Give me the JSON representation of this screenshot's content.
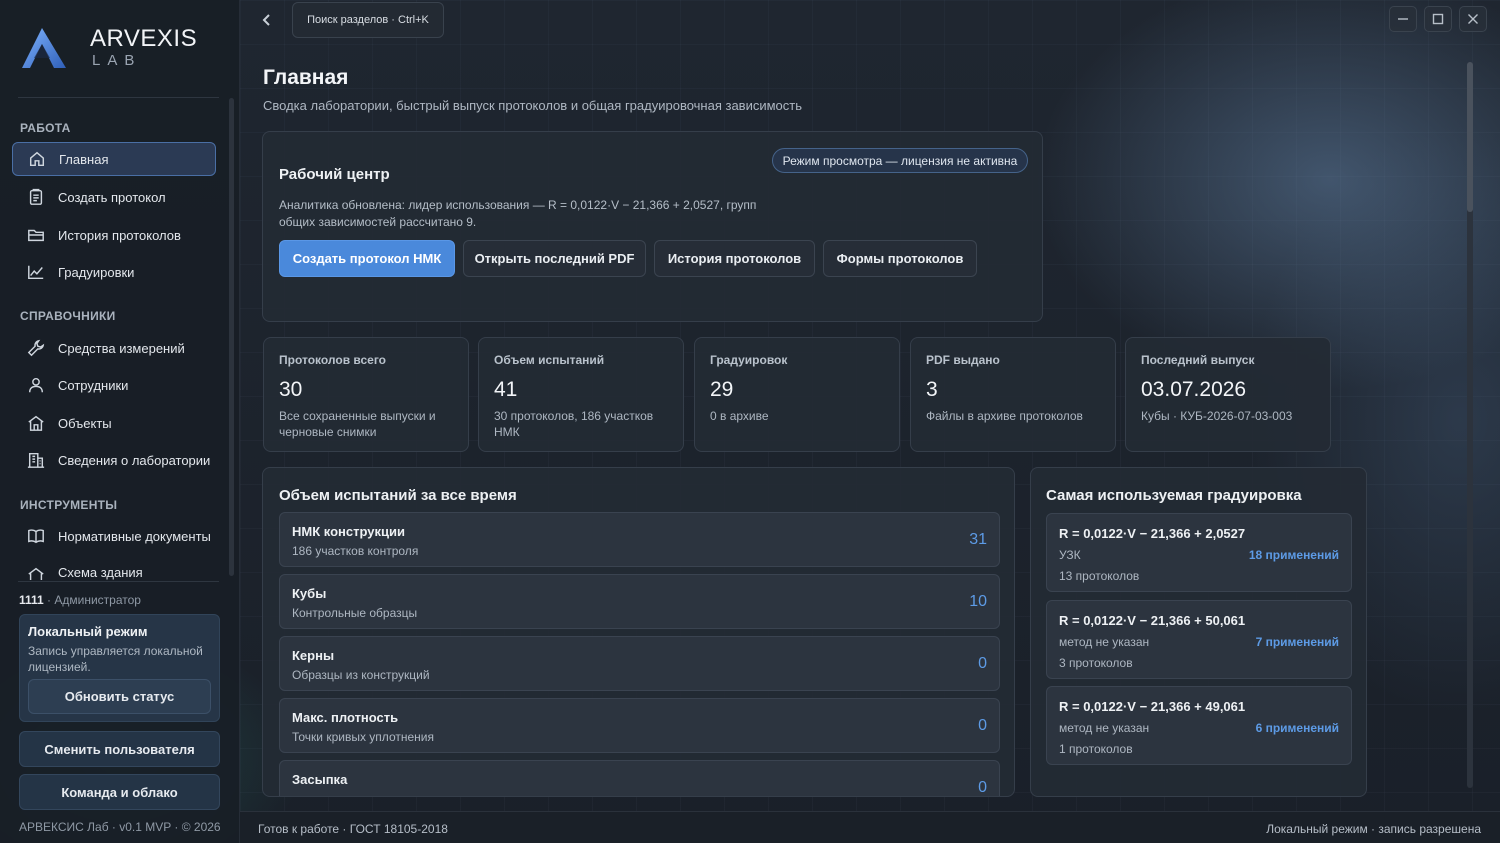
{
  "brand": {
    "title": "ARVEXIS",
    "sub": "LAB"
  },
  "sidebar": {
    "sections": [
      {
        "label": "РАБОТА"
      },
      {
        "label": "СПРАВОЧНИКИ"
      },
      {
        "label": "ИНСТРУМЕНТЫ"
      }
    ],
    "items": [
      {
        "label": "Главная",
        "icon": "home-icon"
      },
      {
        "label": "Создать протокол",
        "icon": "clipboard-icon"
      },
      {
        "label": "История протоколов",
        "icon": "folder-icon"
      },
      {
        "label": "Градуировки",
        "icon": "chart-line-icon"
      },
      {
        "label": "Средства измерений",
        "icon": "wrench-icon"
      },
      {
        "label": "Сотрудники",
        "icon": "user-icon"
      },
      {
        "label": "Объекты",
        "icon": "building-icon"
      },
      {
        "label": "Сведения о лаборатории",
        "icon": "office-icon"
      },
      {
        "label": "Нормативные документы",
        "icon": "book-icon"
      },
      {
        "label": "Схема здания",
        "icon": "house-icon"
      }
    ],
    "user": {
      "id": "1111",
      "role": " · Администратор"
    },
    "local_mode": {
      "title": "Локальный режим",
      "desc": "Запись управляется локальной лицензией.",
      "refresh_label": "Обновить статус"
    },
    "switch_user_label": "Сменить пользователя",
    "team_label": "Команда и облако",
    "footer": "АРВЕКСИС Лаб · v0.1 MVP · © 2026"
  },
  "topbar": {
    "search_text": "Поиск разделов · Ctrl+K"
  },
  "page": {
    "title": "Главная",
    "subtitle": "Сводка лаборатории, быстрый выпуск протоколов и общая градуировочная зависимость"
  },
  "work_center": {
    "title": "Рабочий центр",
    "mode_badge": "Режим просмотра — лицензия не активна",
    "desc": "Аналитика обновлена: лидер использования — R = 0,0122·V − 21,366 + 2,0527, групп общих зависимостей рассчитано 9.",
    "buttons": [
      {
        "label": "Создать протокол НМК"
      },
      {
        "label": "Открыть последний PDF"
      },
      {
        "label": "История протоколов"
      },
      {
        "label": "Формы протоколов"
      }
    ]
  },
  "stats": [
    {
      "label": "Протоколов всего",
      "value": "30",
      "sub": "Все сохраненные выпуски и черновые снимки"
    },
    {
      "label": "Объем испытаний",
      "value": "41",
      "sub": "30 протоколов, 186 участков НМК"
    },
    {
      "label": "Градуировок",
      "value": "29",
      "sub": "0 в архиве"
    },
    {
      "label": "PDF выдано",
      "value": "3",
      "sub": "Файлы в архиве протоколов"
    },
    {
      "label": "Последний выпуск",
      "value": "03.07.2026",
      "sub": "Кубы · КУБ-2026-07-03-003"
    }
  ],
  "volume": {
    "title": "Объем испытаний за все время",
    "rows": [
      {
        "name": "НМК конструкции",
        "desc": "186 участков контроля",
        "count": "31"
      },
      {
        "name": "Кубы",
        "desc": "Контрольные образцы",
        "count": "10"
      },
      {
        "name": "Керны",
        "desc": "Образцы из конструкций",
        "count": "0"
      },
      {
        "name": "Макс. плотность",
        "desc": "Точки кривых уплотнения",
        "count": "0"
      },
      {
        "name": "Засыпка",
        "desc": "",
        "count": "0"
      }
    ]
  },
  "calibration": {
    "title": "Самая используемая градуировка",
    "rows": [
      {
        "formula": "R = 0,0122·V − 21,366 + 2,0527",
        "method": "УЗК",
        "protocols": "13 протоколов",
        "uses": "18 применений"
      },
      {
        "formula": "R = 0,0122·V − 21,366 + 50,061",
        "method": "метод не указан",
        "protocols": "3 протоколов",
        "uses": "7 применений"
      },
      {
        "formula": "R = 0,0122·V − 21,366 + 49,061",
        "method": "метод не указан",
        "protocols": "1 протоколов",
        "uses": "6 применений"
      }
    ]
  },
  "status": {
    "left": "Готов к работе · ГОСТ 18105-2018",
    "right": "Локальный режим · запись разрешена"
  },
  "colors": {
    "accent": "#4a89db",
    "count_blue": "#5d9be6",
    "active_nav": "#2b3a54",
    "card": "#232a34"
  }
}
